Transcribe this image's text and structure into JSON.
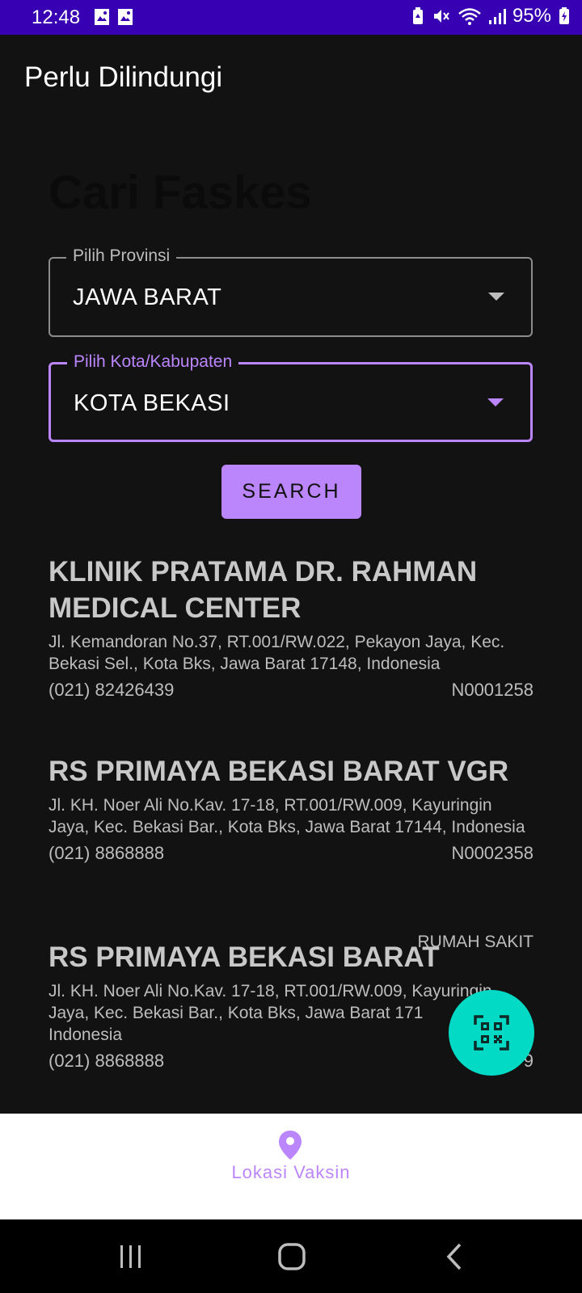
{
  "status_bar": {
    "time": "12:48",
    "battery": "95%",
    "icons": [
      "gallery-icon",
      "gallery-icon",
      "battery-saver-icon",
      "mute-icon",
      "wifi-icon",
      "signal-icon",
      "battery-charging-icon"
    ]
  },
  "app_bar": {
    "title": "Perlu Dilindungi"
  },
  "page": {
    "title": "Cari Faskes"
  },
  "province": {
    "label": "Pilih Provinsi",
    "value": "JAWA BARAT"
  },
  "city": {
    "label": "Pilih Kota/Kabupaten",
    "value": "KOTA BEKASI"
  },
  "search_button": {
    "label": "SEARCH"
  },
  "results": [
    {
      "name": "KLINIK PRATAMA DR. RAHMAN MEDICAL CENTER",
      "address": "Jl. Kemandoran No.37, RT.001/RW.022, Pekayon Jaya, Kec. Bekasi Sel., Kota Bks, Jawa Barat 17148, Indonesia",
      "phone": "(021) 82426439",
      "code": "N0001258"
    },
    {
      "name": "RS PRIMAYA BEKASI BARAT VGR",
      "address": "Jl. KH. Noer Ali No.Kav. 17-18, RT.001/RW.009, Kayuringin Jaya, Kec. Bekasi Bar., Kota Bks, Jawa Barat 17144, Indonesia",
      "phone": "(021) 8868888",
      "code": "N0002358"
    },
    {
      "name": "RS PRIMAYA BEKASI BARAT",
      "category": "RUMAH SAKIT",
      "address": "Jl. KH. Noer Ali No.Kav. 17-18, RT.001/RW.009, Kayuringin Jaya, Kec. Bekasi Bar., Kota Bks, Jawa Barat 171",
      "address_line3": "Indonesia",
      "phone": "(021) 8868888",
      "code": "0    9"
    }
  ],
  "fab": {
    "icon": "qr-scan-icon"
  },
  "bottom_nav": {
    "label": "Lokasi Vaksin",
    "icon": "location-pin-icon"
  },
  "colors": {
    "primary": "#bb86fc",
    "status_bar": "#3700b3",
    "fab": "#03dac5",
    "background": "#121212"
  }
}
